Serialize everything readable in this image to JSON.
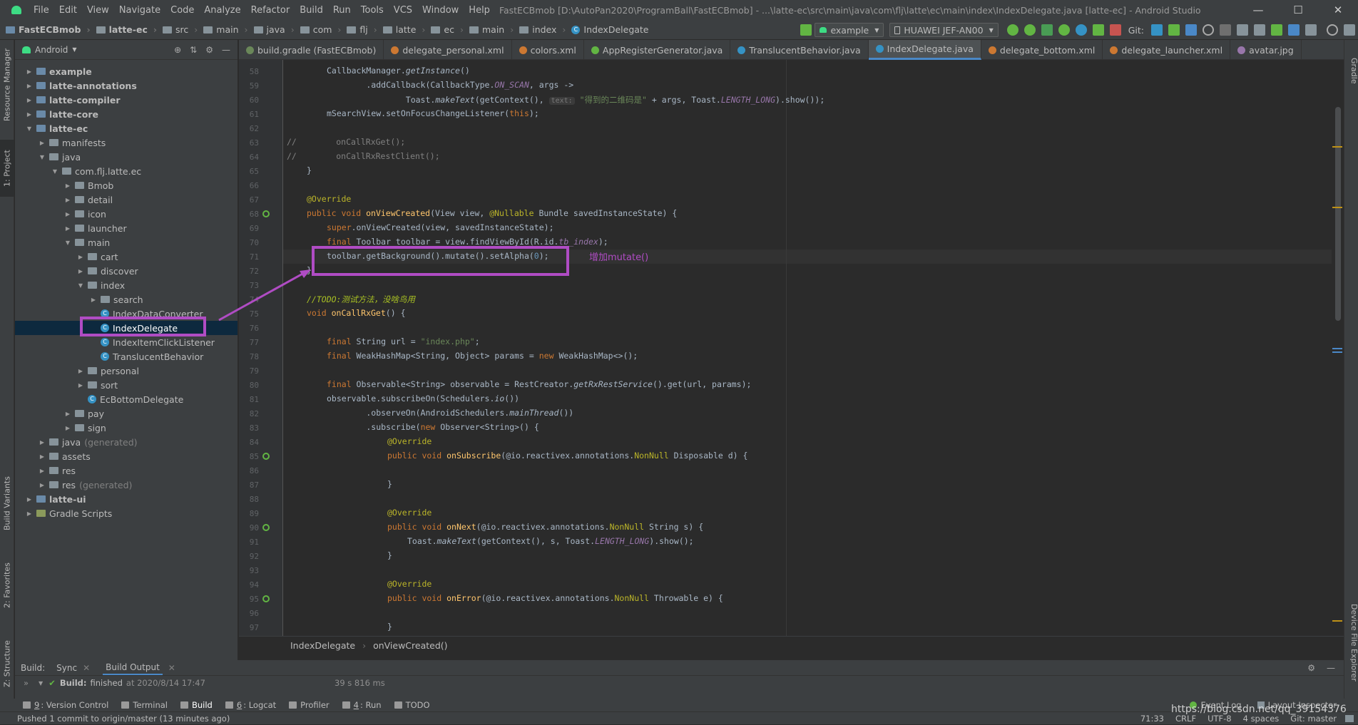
{
  "app": {
    "title": "FastECBmob [D:\\AutoPan2020\\ProgramBall\\FastECBmob] - ...\\latte-ec\\src\\main\\java\\com\\flj\\latte\\ec\\main\\index\\IndexDelegate.java [latte-ec] - Android Studio",
    "menu": [
      "File",
      "Edit",
      "View",
      "Navigate",
      "Code",
      "Analyze",
      "Refactor",
      "Build",
      "Run",
      "Tools",
      "VCS",
      "Window",
      "Help"
    ],
    "window_controls": [
      "—",
      "☐",
      "✕"
    ]
  },
  "breadcrumbs": [
    "FastECBmob",
    "latte-ec",
    "src",
    "main",
    "java",
    "com",
    "flj",
    "latte",
    "ec",
    "main",
    "index",
    "IndexDelegate"
  ],
  "toolbar": {
    "run_config": "example",
    "device": "HUAWEI JEF-AN00",
    "git_label": "Git:"
  },
  "left_tabs": {
    "resource_manager": "Resource Manager",
    "project": "1: Project",
    "build_variants": "Build Variants",
    "favorites": "2: Favorites",
    "structure": "Z: Structure"
  },
  "right_tabs": {
    "gradle": "Gradle",
    "device_file_explorer": "Device File Explorer"
  },
  "project_panel": {
    "view": "Android",
    "tree": [
      {
        "label": "example",
        "bold": true,
        "expanded": false
      },
      {
        "label": "latte-annotations",
        "bold": true,
        "expanded": false
      },
      {
        "label": "latte-compiler",
        "bold": true,
        "expanded": false
      },
      {
        "label": "latte-core",
        "bold": true,
        "expanded": false
      },
      {
        "label": "latte-ec",
        "bold": true,
        "expanded": true
      },
      {
        "label": "manifests",
        "expanded": false
      },
      {
        "label": "java",
        "expanded": true
      },
      {
        "label": "com.flj.latte.ec",
        "expanded": true
      },
      {
        "label": "Bmob",
        "expanded": false
      },
      {
        "label": "detail",
        "expanded": false
      },
      {
        "label": "icon",
        "expanded": false
      },
      {
        "label": "launcher",
        "expanded": false
      },
      {
        "label": "main",
        "expanded": true
      },
      {
        "label": "cart",
        "expanded": false
      },
      {
        "label": "discover",
        "expanded": false
      },
      {
        "label": "index",
        "expanded": true
      },
      {
        "label": "search",
        "expanded": false
      },
      {
        "label": "IndexDataConverter"
      },
      {
        "label": "IndexDelegate",
        "selected": true
      },
      {
        "label": "IndexItemClickListener"
      },
      {
        "label": "TranslucentBehavior"
      },
      {
        "label": "personal",
        "expanded": false
      },
      {
        "label": "sort",
        "expanded": false
      },
      {
        "label": "EcBottomDelegate"
      },
      {
        "label": "pay",
        "expanded": false
      },
      {
        "label": "sign",
        "expanded": false
      },
      {
        "label": "java",
        "suffix": "(generated)",
        "expanded": false
      },
      {
        "label": "assets",
        "expanded": false
      },
      {
        "label": "res",
        "expanded": false
      },
      {
        "label": "res",
        "suffix": "(generated)",
        "expanded": false
      },
      {
        "label": "latte-ui",
        "bold": true,
        "expanded": false
      },
      {
        "label": "Gradle Scripts",
        "expanded": false
      }
    ]
  },
  "editor_tabs": [
    {
      "label": "build.gradle (FastECBmob)",
      "color": "#6a8759"
    },
    {
      "label": "delegate_personal.xml",
      "color": "#cc7832"
    },
    {
      "label": "colors.xml",
      "color": "#cc7832"
    },
    {
      "label": "AppRegisterGenerator.java",
      "color": "#62b543"
    },
    {
      "label": "TranslucentBehavior.java",
      "color": "#3592c4"
    },
    {
      "label": "IndexDelegate.java",
      "color": "#3592c4",
      "active": true
    },
    {
      "label": "delegate_bottom.xml",
      "color": "#cc7832"
    },
    {
      "label": "delegate_launcher.xml",
      "color": "#cc7832"
    },
    {
      "label": "avatar.jpg",
      "color": "#9876aa"
    }
  ],
  "code": {
    "line_numbers": [
      "58",
      "59",
      "60",
      "61",
      "62",
      "63",
      "64",
      "65",
      "66",
      "67",
      "68",
      "69",
      "70",
      "71",
      "72",
      "73",
      "74",
      "75",
      "76",
      "77",
      "78",
      "79",
      "80",
      "81",
      "82",
      "83",
      "84",
      "85",
      "86",
      "87",
      "88",
      "89",
      "90",
      "91",
      "92",
      "93",
      "94",
      "95",
      "96",
      "97"
    ],
    "l58": "CallbackManager.",
    "l58b": "getInstance",
    "l58c": "()",
    "l59a": "        .addCallback(CallbackType.",
    "l59b": "ON_SCAN",
    "l59c": ", args ->",
    "l60a": "                Toast.",
    "l60b": "makeText",
    "l60c": "(getContext(), ",
    "l60hint": "text:",
    "l60d": "\"得到的二维码是\"",
    "l60e": " + args, Toast.",
    "l60f": "LENGTH_LONG",
    "l60g": ").show());",
    "l61": "mSearchView.setOnFocusChangeListener(",
    "l61b": "this",
    "l61c": ");",
    "l63": "//        onCallRxGet();",
    "l64": "//        onCallRxRestClient();",
    "l65": "}",
    "l67": "@Override",
    "l68a": "public void ",
    "l68b": "onViewCreated",
    "l68c": "(View view, ",
    "l68d": "@Nullable",
    "l68e": " Bundle savedInstanceState) {",
    "l69a": "super",
    "l69b": ".onViewCreated(view, savedInstanceState);",
    "l70a": "final ",
    "l70b": "Toolbar toolbar = view.findViewById(R.id.",
    "l70c": "tb_index",
    "l70d": ");",
    "l71a": "toolbar.getBackground().mutate().setAlpha(",
    "l71b": "0",
    "l71c": ");",
    "l72": "}",
    "l74a": "//TODO:",
    "l74b": "测试方法，没啥鸟用",
    "l75a": "void ",
    "l75b": "onCallRxGet",
    "l75c": "() {",
    "l77a": "final ",
    "l77b": "String url = ",
    "l77c": "\"index.php\"",
    "l77d": ";",
    "l78a": "final ",
    "l78b": "WeakHashMap<String, Object> params = ",
    "l78c": "new ",
    "l78d": "WeakHashMap<>();",
    "l80a": "final ",
    "l80b": "Observable<String> observable = RestCreator.",
    "l80c": "getRxRestService",
    "l80d": "().get(url, params);",
    "l81a": "observable.subscribeOn(Schedulers.",
    "l81b": "io",
    "l81c": "())",
    "l82a": "        .observeOn(AndroidSchedulers.",
    "l82b": "mainThread",
    "l82c": "())",
    "l83a": "        .subscribe(",
    "l83b": "new ",
    "l83c": "Observer<String>() {",
    "l84": "@Override",
    "l85a": "public void ",
    "l85b": "onSubscribe",
    "l85c": "(@io.reactivex.annotations.",
    "l85d": "NonNull",
    "l85e": " Disposable d) {",
    "l87": "}",
    "l89": "@Override",
    "l90a": "public void ",
    "l90b": "onNext",
    "l90c": "(@io.reactivex.annotations.",
    "l90d": "NonNull",
    "l90e": " String s) {",
    "l91a": "Toast.",
    "l91b": "makeText",
    "l91c": "(getContext(), s, Toast.",
    "l91d": "LENGTH_LONG",
    "l91e": ").show();",
    "l92": "}",
    "l94": "@Override",
    "l95a": "public void ",
    "l95b": "onError",
    "l95c": "(@io.reactivex.annotations.",
    "l95d": "NonNull",
    "l95e": " Throwable e) {",
    "l97": "}"
  },
  "annotation": {
    "label": "增加mutate()",
    "color": "#b04cc4"
  },
  "editor_breadcrumb": [
    "IndexDelegate",
    "onViewCreated()"
  ],
  "build_panel": {
    "label": "Build:",
    "tabs": [
      "Sync",
      "Build Output"
    ],
    "status_bold": "Build:",
    "status_text": "finished",
    "status_time": "at 2020/8/14 17:47",
    "duration": "39 s 816 ms"
  },
  "bottom_tools": [
    {
      "num": "9",
      "label": ": Version Control"
    },
    {
      "num": "",
      "label": "Terminal"
    },
    {
      "num": "",
      "label": "Build"
    },
    {
      "num": "6",
      "label": ": Logcat"
    },
    {
      "num": "",
      "label": "Profiler"
    },
    {
      "num": "4",
      "label": ": Run"
    },
    {
      "num": "",
      "label": "TODO"
    }
  ],
  "bottom_right_tools": [
    "Event Log",
    "Layout Inspector"
  ],
  "status": {
    "message": "Pushed 1 commit to origin/master (13 minutes ago)",
    "position": "71:33",
    "line_sep": "CRLF",
    "encoding": "UTF-8",
    "indent": "4 spaces",
    "vcs": "Git: master",
    "watermark": "https://blog.csdn.net/qq_39154376"
  }
}
